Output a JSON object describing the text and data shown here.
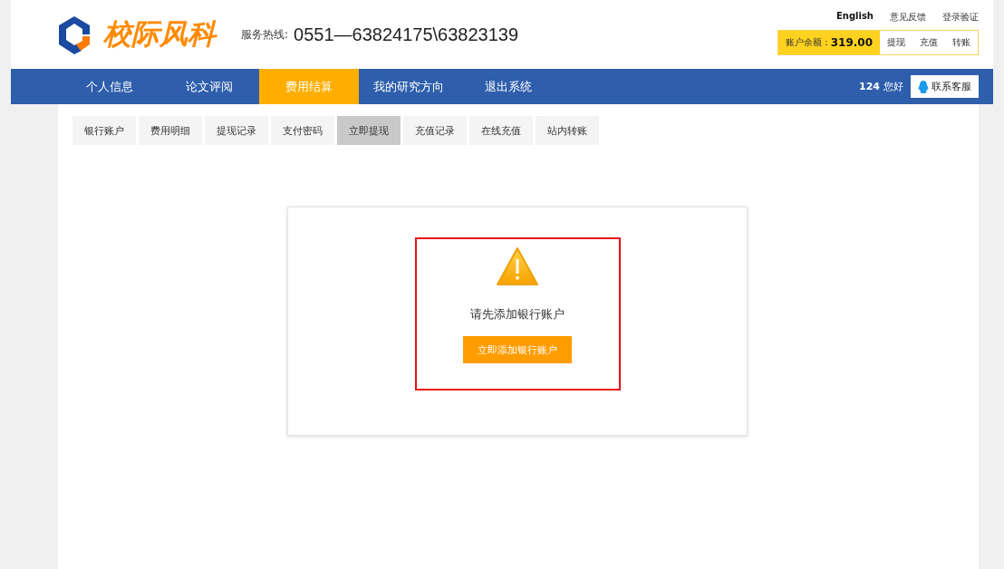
{
  "header": {
    "logo_text": "校际风科",
    "hotline_label": "服务热线:",
    "hotline": "0551—63824175\\63823139",
    "top_links": [
      "English",
      "意见反馈",
      "登录验证"
    ],
    "balance": {
      "label": "账户余额：",
      "amount": "319.00",
      "actions": [
        "提现",
        "充值",
        "转账"
      ]
    }
  },
  "nav": {
    "items": [
      {
        "label": "个人信息",
        "selected": false
      },
      {
        "label": "论文评阅",
        "selected": false
      },
      {
        "label": "费用结算",
        "selected": true
      },
      {
        "label": "我的研究方向",
        "selected": false
      },
      {
        "label": "退出系统",
        "selected": false
      }
    ],
    "user_id": "124",
    "greeting": "您好",
    "contact_button": "联系客服"
  },
  "subtabs": [
    {
      "label": "银行账户",
      "selected": false
    },
    {
      "label": "费用明细",
      "selected": false
    },
    {
      "label": "提现记录",
      "selected": false
    },
    {
      "label": "支付密码",
      "selected": false
    },
    {
      "label": "立即提现",
      "selected": true
    },
    {
      "label": "充值记录",
      "selected": false
    },
    {
      "label": "在线充值",
      "selected": false
    },
    {
      "label": "站内转账",
      "selected": false
    }
  ],
  "notice": {
    "message": "请先添加银行账户",
    "button": "立即添加银行账户"
  }
}
